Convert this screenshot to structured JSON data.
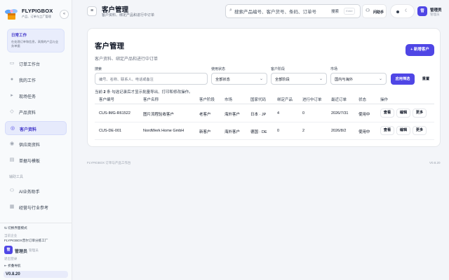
{
  "brand": {
    "name": "FLYPIGBOX",
    "subtitle": "产品、订单与工厂管理",
    "collapse_icon": "chevron-double-left-icon"
  },
  "workcard": {
    "title": "日常工作",
    "text": "在处理订单和信息，高频的产品与业务单据"
  },
  "sidebar": {
    "items": [
      {
        "label": "订单工作台",
        "icon": "clipboard-icon"
      },
      {
        "label": "我的工作",
        "icon": "dot-icon"
      },
      {
        "label": "现场任务",
        "icon": "play-icon"
      },
      {
        "label": "产品资料",
        "icon": "diamond-icon"
      },
      {
        "label": "客户资料",
        "icon": "target-icon",
        "active": true
      },
      {
        "label": "供应商资料",
        "icon": "record-icon"
      },
      {
        "label": "单据与模板",
        "icon": "document-icon"
      }
    ],
    "section_label": "辅助工具",
    "tools": [
      {
        "label": "AI业务助手",
        "icon": "robot-icon"
      },
      {
        "label": "经营与行业参考",
        "icon": "grid-icon"
      }
    ],
    "bottom": {
      "switch_label": "切换界面模式",
      "current_company_label": "当前企业",
      "company_name": "FLYPIGBOX普尔订单分拣工厂",
      "user_name": "管理员",
      "user_role": "管理员",
      "avatar_text": "管",
      "logout_label": "退出登录",
      "fold_label": "折叠导航",
      "version": "V0.8.20"
    }
  },
  "topbar": {
    "title": "客户管理",
    "subtitle": "客户资料、绑定产品和进行中订单",
    "search_placeholder": "搜索产品编号、客户货号、条码、订单号",
    "search_button": "搜索",
    "search_shortcut": "Enter",
    "assistant_label": "问助手",
    "user_name": "管理员",
    "user_role": "管理员",
    "avatar_text": "管"
  },
  "card": {
    "title": "客户管理",
    "subtitle": "客户资料、绑定产品和进行中订单",
    "add_button": "+ 新增客户",
    "filters": {
      "search_label": "搜索",
      "search_placeholder": "编号、名称、联系人、电话或备注",
      "status_label": "使用状态",
      "status_value": "全部状态",
      "stage_label": "客户阶段",
      "stage_value": "全部阶段",
      "market_label": "市场",
      "market_value": "国内与海外",
      "apply_button": "应用筛选",
      "reset_button": "重置"
    },
    "count_prefix": "当前",
    "count_value": "2",
    "count_suffix": "条   勾选记录后才显示批量导出、打印和修改操作。"
  },
  "table": {
    "headers": [
      "客户编号",
      "客户名称",
      "客户阶段",
      "市场",
      "国家代码",
      "绑定产品",
      "进行中订单",
      "最近订单",
      "状态",
      "操作"
    ],
    "rows": [
      {
        "id": "CUS-IMG-R61522",
        "name": "图片流程验收客户",
        "stage": "老客户",
        "market": "海外客户",
        "country": "日本 · JP",
        "products": "4",
        "orders": "0",
        "last_order": "2026/7/31",
        "status": "使用中"
      },
      {
        "id": "CUS-DE-001",
        "name": "NordWerk Home GmbH",
        "stage": "新客户",
        "market": "海外客户",
        "country": "德国 · DE",
        "products": "0",
        "orders": "2",
        "last_order": "2026/8/2",
        "status": "使用中"
      }
    ],
    "actions": {
      "view": "查看",
      "edit": "编辑",
      "more": "更多"
    }
  },
  "footer": {
    "left": "FLYPIGBOX 订单与产品工作台",
    "right": "V0.8.20"
  },
  "colors": {
    "accent": "#4f46e5",
    "active_bg": "#e6eafc",
    "page_bg": "#f3f5f9"
  }
}
